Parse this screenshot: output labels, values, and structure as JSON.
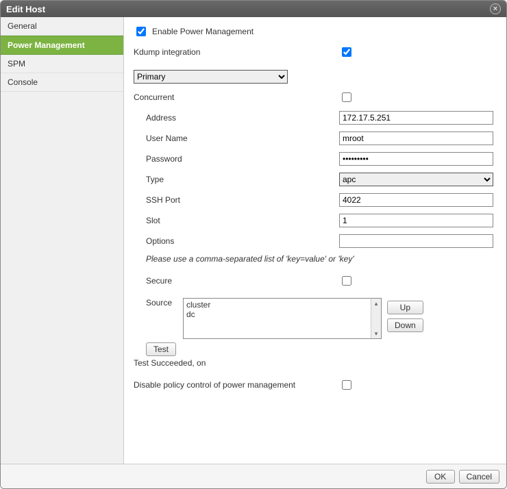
{
  "title": "Edit Host",
  "close_glyph": "×",
  "sidebar": {
    "items": [
      {
        "label": "General"
      },
      {
        "label": "Power Management"
      },
      {
        "label": "SPM"
      },
      {
        "label": "Console"
      }
    ],
    "active_index": 1
  },
  "pm": {
    "enable_label": "Enable Power Management",
    "enable_checked": true,
    "kdump_label": "Kdump integration",
    "kdump_checked": true,
    "primary_options": [
      "Primary"
    ],
    "primary_value": "Primary",
    "concurrent_label": "Concurrent",
    "concurrent_checked": false,
    "address_label": "Address",
    "address_value": "172.17.5.251",
    "username_label": "User Name",
    "username_value": "mroot",
    "password_label": "Password",
    "password_value": "•••••••••",
    "type_label": "Type",
    "type_options": [
      "apc"
    ],
    "type_value": "apc",
    "sshport_label": "SSH Port",
    "sshport_value": "4022",
    "slot_label": "Slot",
    "slot_value": "1",
    "options_label": "Options",
    "options_value": "",
    "options_hint": "Please use a comma-separated list of 'key=value' or 'key'",
    "secure_label": "Secure",
    "secure_checked": false,
    "source_label": "Source",
    "source_items": [
      "cluster",
      "dc"
    ],
    "up_label": "Up",
    "down_label": "Down",
    "test_label": "Test",
    "test_status": "Test Succeeded, on",
    "disable_policy_label": "Disable policy control of power management",
    "disable_policy_checked": false
  },
  "footer": {
    "ok": "OK",
    "cancel": "Cancel"
  }
}
